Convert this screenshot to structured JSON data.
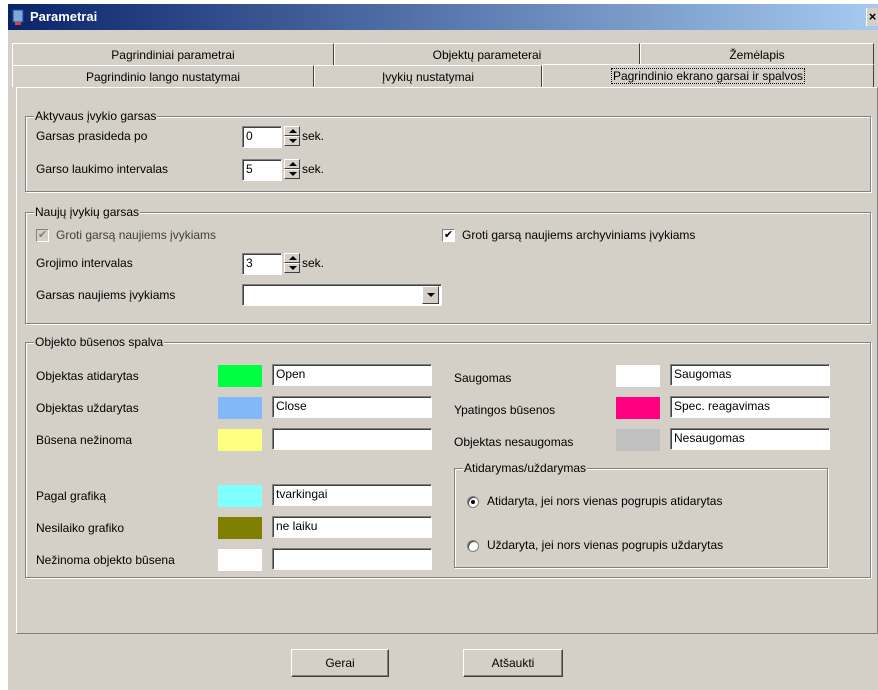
{
  "window": {
    "title": "Parametrai",
    "close": "×"
  },
  "tabs_row1": [
    {
      "label": "Pagrindiniai parametrai"
    },
    {
      "label": "Objektų parameterai"
    },
    {
      "label": "Žemėlapis"
    }
  ],
  "tabs_row2": [
    {
      "label": "Pagrindinio lango nustatymai"
    },
    {
      "label": "Įvykių nustatymai"
    },
    {
      "label": "Pagrindinio ekrano garsai ir spalvos",
      "active": true
    }
  ],
  "active_sound": {
    "title": "Aktyvaus įvykio garsas",
    "start_label": "Garsas prasideda po",
    "start_value": "0",
    "wait_label": "Garso laukimo intervalas",
    "wait_value": "5",
    "unit": "sek."
  },
  "new_sound": {
    "title": "Naujų įvykių garsas",
    "play_new_label": "Groti garsą naujiems įvykiams",
    "play_new_checked": true,
    "play_archive_label": "Groti garsą naujiems archyviniams įvykiams",
    "play_archive_checked": true,
    "interval_label": "Grojimo intervalas",
    "interval_value": "3",
    "unit": "sek.",
    "sound_label": "Garsas naujiems įvykiams",
    "sound_value": "",
    "check_mark": "✔"
  },
  "status_colors": {
    "title": "Objekto būsenos spalva",
    "left": [
      {
        "label": "Objektas atidarytas",
        "color": "#00ff40",
        "text": "Open"
      },
      {
        "label": "Objektas uždarytas",
        "color": "#80b8f8",
        "text": "Close"
      },
      {
        "label": "Būsena nežinoma",
        "color": "#ffff80",
        "text": ""
      },
      {
        "label": "Pagal grafiką",
        "color": "#80ffff",
        "text": "tvarkingai"
      },
      {
        "label": "Nesilaiko grafiko",
        "color": "#808000",
        "text": "ne laiku"
      },
      {
        "label": "Nežinoma objekto būsena",
        "color": "#ffffff",
        "text": ""
      }
    ],
    "right": [
      {
        "label": "Saugomas",
        "color": "#ffffff",
        "text": "Saugomas"
      },
      {
        "label": "Ypatingos būsenos",
        "color": "#ff0080",
        "text": "Spec. reagavimas"
      },
      {
        "label": "Objektas nesaugomas",
        "color": "#c0c0c0",
        "text": "Nesaugomas"
      }
    ],
    "open_close": {
      "title": "Atidarymas/uždarymas",
      "option1": "Atidaryta, jei nors vienas pogrupis atidarytas",
      "option2": "Uždaryta, jei nors vienas pogrupis uždarytas",
      "selected": 1
    }
  },
  "buttons": {
    "ok": "Gerai",
    "cancel": "Atšaukti"
  }
}
